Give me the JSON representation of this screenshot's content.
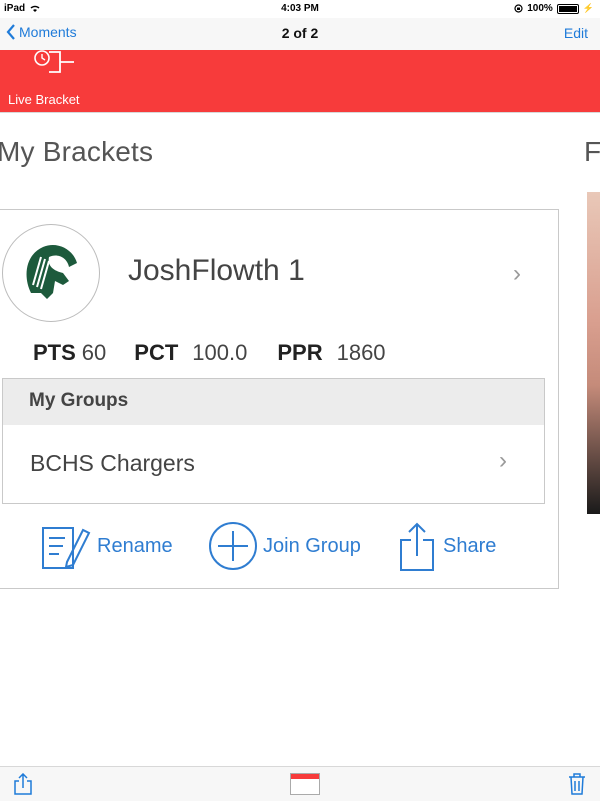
{
  "status_bar": {
    "device": "iPad",
    "time": "4:03 PM",
    "battery": "100%"
  },
  "nav": {
    "back_label": "Moments",
    "title": "2 of 2",
    "edit_label": "Edit"
  },
  "header": {
    "live_bracket_label": "Live Bracket"
  },
  "section": {
    "title": "My Brackets",
    "right_title_fragment": "F"
  },
  "bracket": {
    "name": "JoshFlowth 1",
    "stats": [
      {
        "label": "PTS",
        "value": "60"
      },
      {
        "label": "PCT",
        "value": "100.0"
      },
      {
        "label": "PPR",
        "value": "1860"
      }
    ],
    "groups_header": "My Groups",
    "groups": [
      {
        "name": "BCHS Chargers"
      }
    ],
    "actions": {
      "rename": "Rename",
      "join_group": "Join Group",
      "share": "Share"
    }
  },
  "colors": {
    "accent": "#1f7bd9",
    "header_red": "#f73b3b",
    "avatar_green": "#1d5a3c"
  }
}
